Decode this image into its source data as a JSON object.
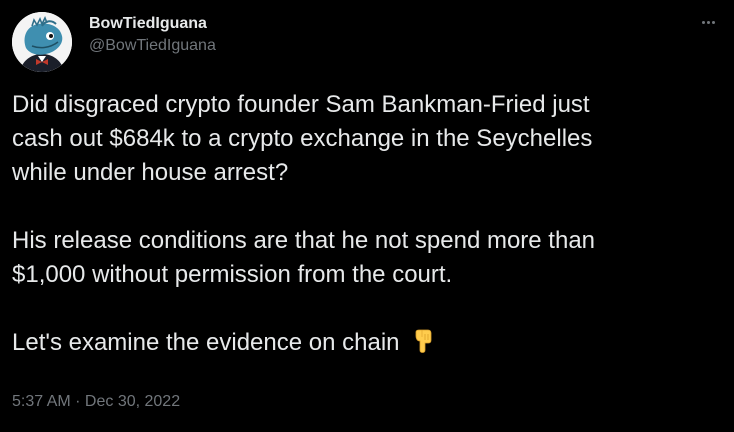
{
  "author": {
    "display_name": "BowTiedIguana",
    "handle": "@BowTiedIguana",
    "avatar_icon": "iguana-avatar-icon"
  },
  "tweet": {
    "paragraph_1": "Did disgraced crypto founder Sam Bankman-Fried just\ncash out $684k to a crypto exchange in the Seychelles\nwhile under house arrest?",
    "paragraph_2": "His release conditions are that he not spend more than\n$1,000 without permission from the court.",
    "paragraph_3": "Let's examine the evidence on chain",
    "emoji_icon": "pointing-down-hand-icon",
    "timestamp": "5:37 AM · Dec 30, 2022"
  },
  "colors": {
    "background": "#000000",
    "text": "#e7e9ea",
    "secondary_text": "#71767b"
  },
  "menu": {
    "icon": "more-options-icon"
  }
}
